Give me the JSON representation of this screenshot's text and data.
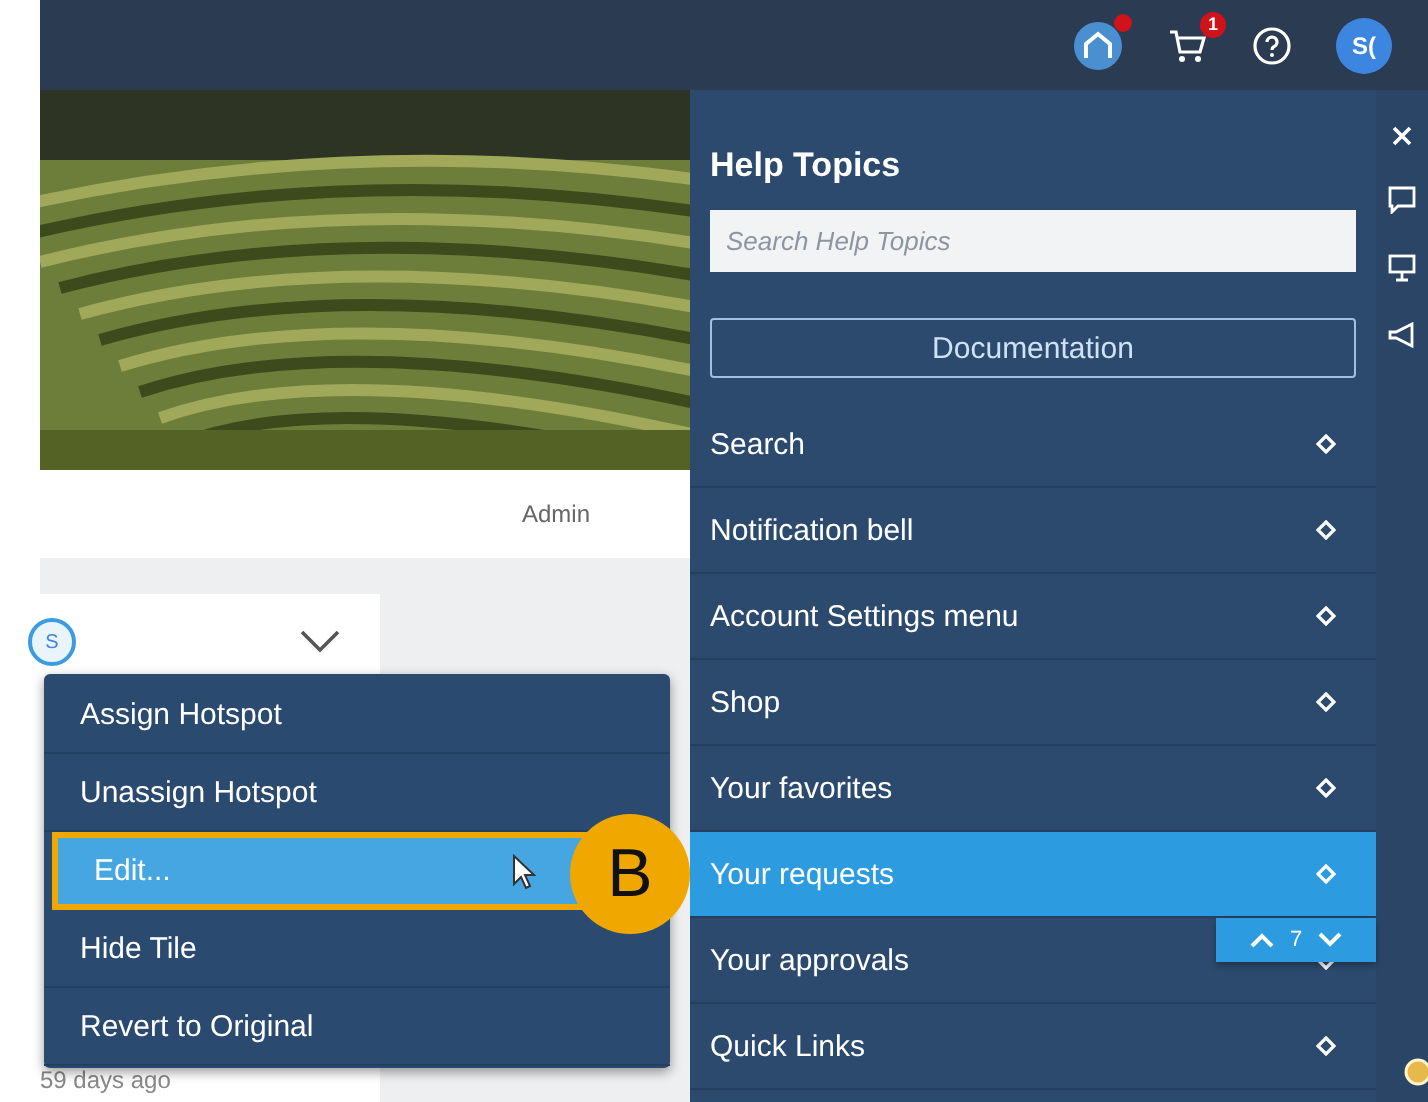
{
  "top_bar": {
    "cart_badge": "1",
    "avatar": "S("
  },
  "tile_strip": {
    "label": "Admin"
  },
  "tile": {
    "avatar": "S",
    "time": "59 days ago"
  },
  "context_menu": {
    "items": [
      {
        "label": "Assign Hotspot",
        "selected": false
      },
      {
        "label": "Unassign Hotspot",
        "selected": false
      },
      {
        "label": "Edit...",
        "selected": true
      },
      {
        "label": "Hide Tile",
        "selected": false
      },
      {
        "label": "Revert to Original",
        "selected": false
      }
    ]
  },
  "callout": {
    "label": "B"
  },
  "help_panel": {
    "title": "Help Topics",
    "search": {
      "placeholder": "Search Help Topics"
    },
    "button": "Documentation",
    "topics": [
      {
        "label": "Search",
        "selected": false
      },
      {
        "label": "Notification bell",
        "selected": false
      },
      {
        "label": "Account Settings menu",
        "selected": false
      },
      {
        "label": "Shop",
        "selected": false
      },
      {
        "label": "Your favorites",
        "selected": false
      },
      {
        "label": "Your requests",
        "selected": true
      },
      {
        "label": "Your approvals",
        "selected": false
      },
      {
        "label": "Quick Links",
        "selected": false
      }
    ],
    "pager": {
      "count": "7"
    }
  }
}
